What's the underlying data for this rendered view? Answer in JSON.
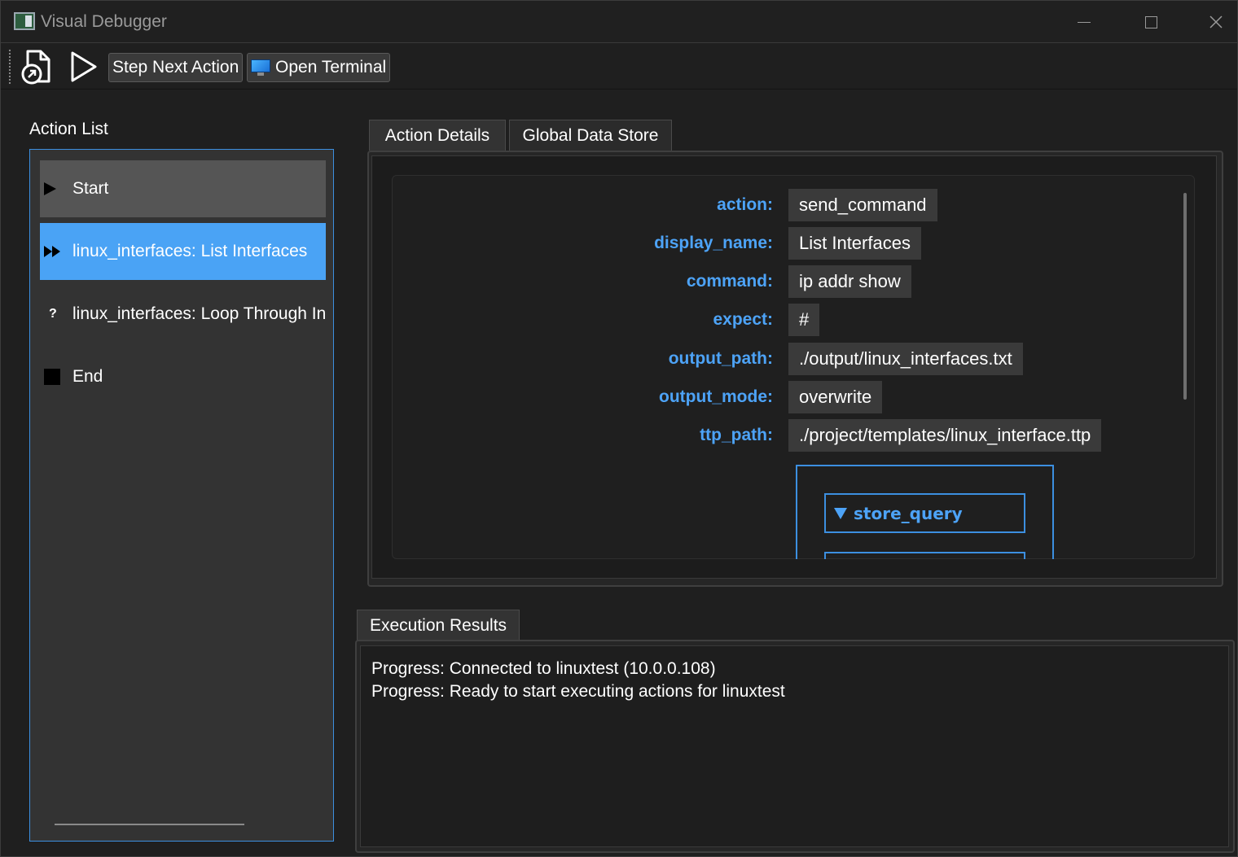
{
  "window": {
    "title": "Visual Debugger"
  },
  "toolbar": {
    "open_icon": "file-open-icon",
    "run_icon": "play-icon",
    "step_label": "Step Next Action",
    "terminal_label": "Open Terminal",
    "terminal_icon": "monitor-icon"
  },
  "action_list": {
    "label": "Action List",
    "items": [
      {
        "label": "Start",
        "icon": "triangle-play-icon",
        "state": "done"
      },
      {
        "label": "linux_interfaces: List Interfaces",
        "icon": "fast-forward-icon",
        "state": "current"
      },
      {
        "label": "linux_interfaces: Loop Through Int",
        "icon": "question-icon",
        "state": "pending"
      },
      {
        "label": "End",
        "icon": "stop-square-icon",
        "state": "pending"
      }
    ]
  },
  "tabs": {
    "action_details": "Action Details",
    "global_data_store": "Global Data Store",
    "active": "Action Details"
  },
  "details": {
    "fields": [
      {
        "key": "action:",
        "value": "send_command"
      },
      {
        "key": "display_name:",
        "value": "List Interfaces"
      },
      {
        "key": "command:",
        "value": "ip addr show"
      },
      {
        "key": "expect:",
        "value": "#"
      },
      {
        "key": "output_path:",
        "value": "./output/linux_interfaces.txt"
      },
      {
        "key": "output_mode:",
        "value": "overwrite"
      },
      {
        "key": "ttp_path:",
        "value": "./project/templates/linux_interface.ttp"
      }
    ],
    "store_query_label": "store_query"
  },
  "execution": {
    "tab_label": "Execution Results",
    "lines": [
      "Progress: Connected to linuxtest (10.0.0.108)",
      "Progress: Ready to start executing actions for linuxtest"
    ]
  },
  "colors": {
    "accent": "#4da3f7",
    "selected_item": "#4aa3f5",
    "started_item": "#555555"
  }
}
